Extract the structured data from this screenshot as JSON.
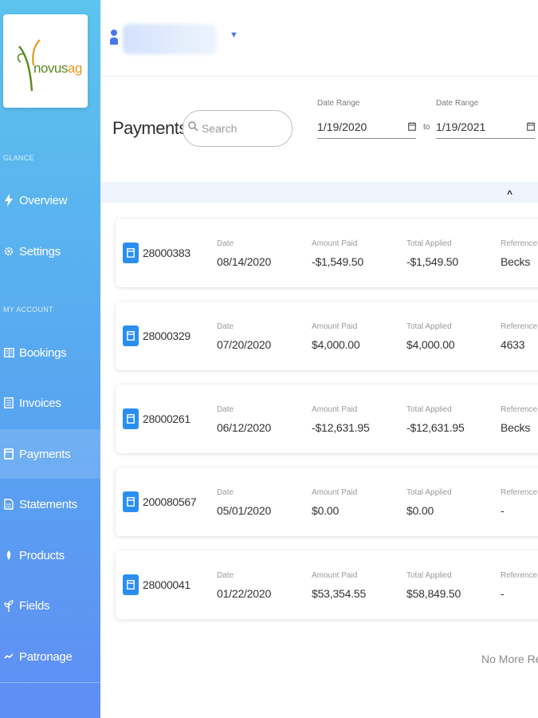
{
  "brand": {
    "logo_part1": "novus",
    "logo_part2": "ag"
  },
  "sidebar": {
    "sections": [
      {
        "label": "GLANCE"
      },
      {
        "label": "MY ACCOUNT"
      }
    ],
    "items": [
      {
        "label": "Overview",
        "icon": "bolt-icon"
      },
      {
        "label": "Settings",
        "icon": "gear-icon"
      },
      {
        "label": "Bookings",
        "icon": "book-icon"
      },
      {
        "label": "Invoices",
        "icon": "invoice-icon"
      },
      {
        "label": "Payments",
        "icon": "payment-card-icon",
        "active": true
      },
      {
        "label": "Statements",
        "icon": "statement-icon"
      },
      {
        "label": "Products",
        "icon": "products-icon"
      },
      {
        "label": "Fields",
        "icon": "fields-icon"
      },
      {
        "label": "Patronage",
        "icon": "patronage-icon"
      }
    ]
  },
  "header": {
    "title": "Payments",
    "search_placeholder": "Search",
    "date_range_label_start": "Date Range",
    "date_range_label_end": "Date Range",
    "start_date": "1/19/2020",
    "end_date": "1/19/2021",
    "to_label": "to"
  },
  "table": {
    "labels": {
      "date": "Date",
      "amount_paid": "Amount Paid",
      "total_applied": "Total Applied",
      "reference": "Reference #"
    },
    "rows": [
      {
        "id": "28000383",
        "date": "08/14/2020",
        "amount_paid": "-$1,549.50",
        "total_applied": "-$1,549.50",
        "reference": "Becks"
      },
      {
        "id": "28000329",
        "date": "07/20/2020",
        "amount_paid": "$4,000.00",
        "total_applied": "$4,000.00",
        "reference": "4633"
      },
      {
        "id": "28000261",
        "date": "06/12/2020",
        "amount_paid": "-$12,631.95",
        "total_applied": "-$12,631.95",
        "reference": "Becks"
      },
      {
        "id": "200080567",
        "date": "05/01/2020",
        "amount_paid": "$0.00",
        "total_applied": "$0.00",
        "reference": "-"
      },
      {
        "id": "28000041",
        "date": "01/22/2020",
        "amount_paid": "$53,354.55",
        "total_applied": "$58,849.50",
        "reference": "-"
      }
    ],
    "footer": "No More Results"
  },
  "colors": {
    "sidebar_top": "#5cc4ee",
    "sidebar_bottom": "#5f8ef4",
    "accent": "#2a8ef0"
  }
}
